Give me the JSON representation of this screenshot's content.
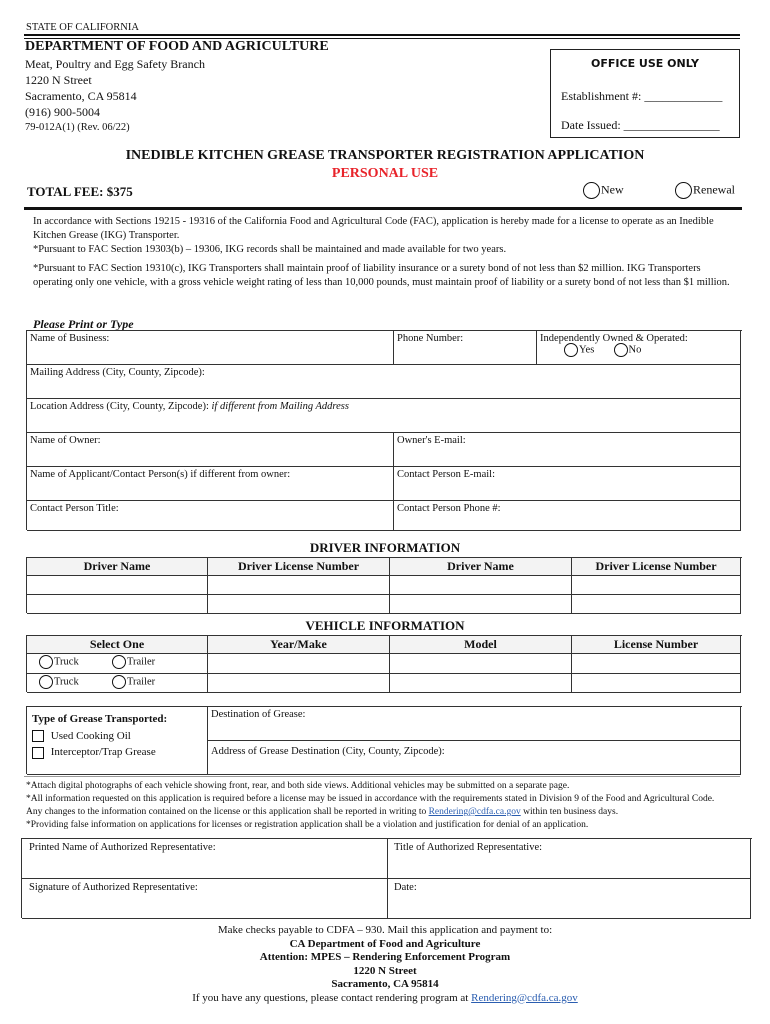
{
  "header": {
    "state": "STATE OF CALIFORNIA",
    "department": "DEPARTMENT OF FOOD AND AGRICULTURE",
    "branch": "Meat, Poultry and Egg Safety Branch",
    "street": "1220 N Street",
    "city": "Sacramento, CA  95814",
    "phone": "(916) 900-5004",
    "form_id": "79-012A(1)  (Rev. 06/22)"
  },
  "office_use": {
    "title": "OFFICE USE ONLY",
    "establishment_label": "Establishment #: _____________",
    "date_issued_label": "Date Issued: ________________"
  },
  "title": {
    "main": "INEDIBLE KITCHEN GREASE TRANSPORTER REGISTRATION APPLICATION",
    "sub": "PERSONAL USE",
    "sub_color": "#e8232a",
    "total_fee": "TOTAL FEE: $375",
    "new_label": "New",
    "renewal_label": "Renewal"
  },
  "intro": {
    "p1": "In accordance with Sections 19215 - 19316 of the California Food and Agricultural Code (FAC), application is hereby made for a license to operate as an Inedible Kitchen Grease (IKG) Transporter.",
    "p2": "*Pursuant to FAC Section 19303(b) – 19306, IKG records shall be maintained and made available for two years.",
    "p3": "*Pursuant to FAC Section 19310(c), IKG Transporters shall maintain proof of liability insurance or a surety bond of not less than $2 million. IKG Transporters operating only one vehicle, with a gross vehicle weight rating of less than 10,000 pounds, must maintain proof of liability or a surety bond of not less than $1 million."
  },
  "form": {
    "instructions": "Please Print or Type",
    "business_name": "Name of Business:",
    "phone_number": "Phone Number:",
    "independently_owned": "Independently Owned & Operated:",
    "yes_label": "Yes",
    "no_label": "No",
    "mailing_address": "Mailing Address (City, County, Zipcode):",
    "location_address": "Location Address (City, County, Zipcode): ",
    "location_note": "if different from Mailing Address",
    "owner_name": "Name of Owner:",
    "owner_email": "Owner's E-mail:",
    "applicant_name": "Name of Applicant/Contact Person(s) if different from owner:",
    "contact_email": "Contact Person E-mail:",
    "contact_title": "Contact Person Title:",
    "contact_phone": "Contact Person Phone #:"
  },
  "driver_info": {
    "title": "DRIVER INFORMATION",
    "columns": [
      "Driver Name",
      "Driver License Number",
      "Driver Name",
      "Driver License Number"
    ],
    "rows": [
      [
        "",
        "",
        "",
        ""
      ],
      [
        "",
        "",
        "",
        ""
      ]
    ]
  },
  "vehicle_info": {
    "title": "VEHICLE INFORMATION",
    "columns": [
      "Select One",
      "Year/Make",
      "Model",
      "License Number"
    ],
    "truck_label": "Truck",
    "trailer_label": "Trailer",
    "rows": [
      [
        "",
        "",
        ""
      ],
      [
        "",
        "",
        ""
      ]
    ]
  },
  "grease": {
    "type_label": "Type of Grease Transported:",
    "option1": "Used Cooking Oil",
    "option2": "Interceptor/Trap Grease",
    "destination": "Destination of Grease:",
    "destination_address": "Address of Grease Destination (City, County, Zipcode):"
  },
  "notes": {
    "n1": "*Attach digital photographs of each vehicle showing front, rear, and both side views. Additional vehicles may be submitted on a separate page.",
    "n2a": "*All information requested on this application is required before a license may be issued in accordance with the requirements stated in Division 9 of the Food and Agricultural Code. Any changes to the information contained on the license or this application shall be reported in writing to ",
    "n2_link": "Rendering@cdfa.ca.gov",
    "n2b": " within ten business days.",
    "n3": "*Providing false information on applications for licenses or registration application shall be a violation and justification for denial of an application."
  },
  "signature": {
    "printed_name": "Printed Name of Authorized Representative:",
    "title": "Title of Authorized Representative:",
    "signature": "Signature of Authorized Representative:",
    "date": "Date:"
  },
  "footer": {
    "line1": "Make checks payable to CDFA – 930.  Mail this application and payment to:",
    "line2": "CA Department of Food and Agriculture",
    "line3": "Attention: MPES – Rendering Enforcement Program",
    "line4": "1220 N Street",
    "line5": "Sacramento, CA 95814",
    "line6": "If you have any questions, please contact rendering program at ",
    "email": "Rendering@cdfa.ca.gov"
  }
}
